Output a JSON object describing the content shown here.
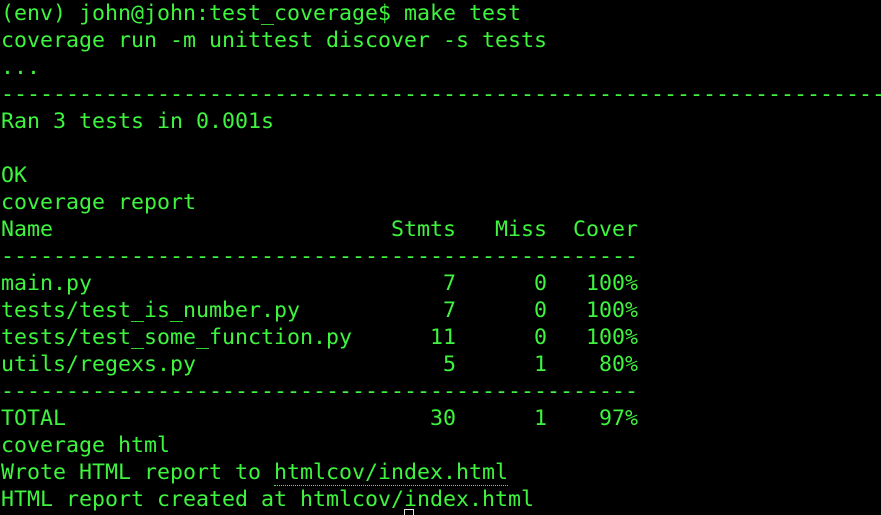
{
  "terminal": {
    "prompt": "(env) john@john:test_coverage$ ",
    "command": "make test",
    "run_cmd": "coverage run -m unittest discover -s tests",
    "dots": "...",
    "separator_long": "----------------------------------------------------------------------",
    "ran": "Ran 3 tests in 0.001s",
    "ok": "OK",
    "report_cmd": "coverage report",
    "header": "Name                          Stmts   Miss  Cover",
    "separator_short": "-------------------------------------------------",
    "rows": [
      "main.py                           7      0   100%",
      "tests/test_is_number.py           7      0   100%",
      "tests/test_some_function.py      11      0   100%",
      "utils/regexs.py                   5      1    80%"
    ],
    "separator_short2": "-------------------------------------------------",
    "total": "TOTAL                            30      1    97%",
    "html_cmd": "coverage html",
    "wrote_prefix": "Wrote HTML report to ",
    "wrote_link": "htmlcov/index.html",
    "created": "HTML report created at htmlcov/index.html"
  },
  "colors": {
    "background": "#000000",
    "text": "#3ef43e",
    "cursor": "#e8e8e8"
  }
}
